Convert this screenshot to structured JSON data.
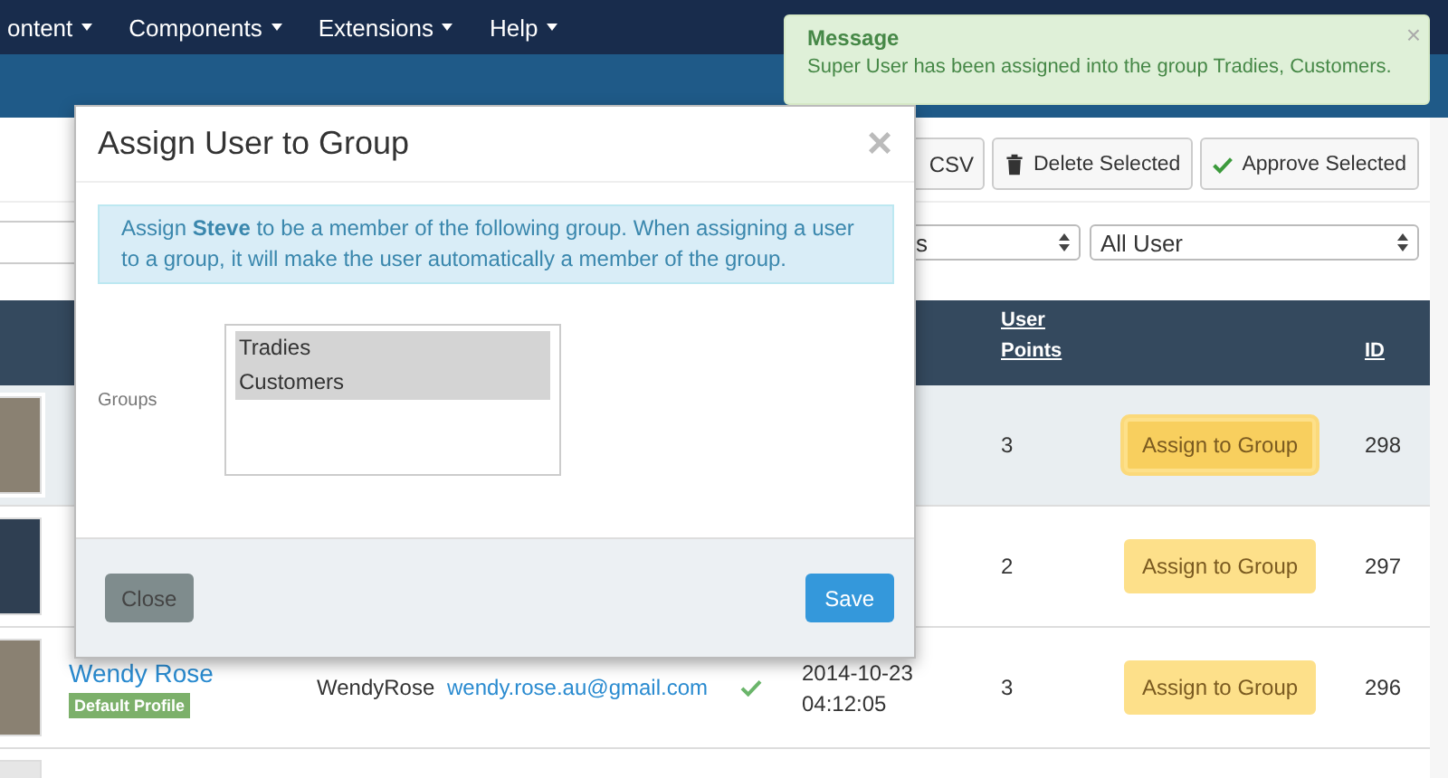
{
  "navbar": {
    "items": [
      {
        "label": "ontent"
      },
      {
        "label": "Components"
      },
      {
        "label": "Extensions"
      },
      {
        "label": "Help"
      }
    ]
  },
  "toolbar": {
    "buttons": [
      {
        "label": "CSV",
        "kind": "plain"
      },
      {
        "label": "Delete Selected",
        "kind": "delete"
      },
      {
        "label": "Approve Selected",
        "kind": "approve"
      }
    ]
  },
  "filters": [
    {
      "value": "s"
    },
    {
      "value": "All User"
    }
  ],
  "table": {
    "columns": [
      {
        "label": "User Points"
      },
      {
        "label": "ID"
      }
    ],
    "rows": [
      {
        "kind": "photo",
        "highlighted": true,
        "points": "3",
        "action": "Assign to Group",
        "focused": true,
        "id": "298"
      },
      {
        "kind": "cartoon",
        "highlighted": false,
        "points": "2",
        "action": "Assign to Group",
        "focused": false,
        "id": "297"
      },
      {
        "kind": "photo",
        "highlighted": false,
        "name": "Wendy Rose",
        "badge": "Default Profile",
        "username": "WendyRose",
        "email": "wendy.rose.au@gmail.com",
        "approved": true,
        "date": "2014-10-23",
        "time": "04:12:05",
        "points": "3",
        "action": "Assign to Group",
        "focused": false,
        "id": "296"
      }
    ]
  },
  "modal": {
    "title": "Assign User to Group",
    "close": "×",
    "info": "Assign **Steve** to be a member of the following group. When assigning a user to a group, it will make the user automatically a member of the group.",
    "field_label": "Groups",
    "options": [
      {
        "label": "Tradies",
        "selected": true
      },
      {
        "label": "Customers",
        "selected": true
      }
    ],
    "buttons": [
      {
        "label": "Close",
        "kind": "secondary"
      },
      {
        "label": "Save",
        "kind": "primary"
      }
    ]
  },
  "message": {
    "title": "Message",
    "text": "Super User has been assigned into the group Tradies, Customers.",
    "close": "×"
  }
}
